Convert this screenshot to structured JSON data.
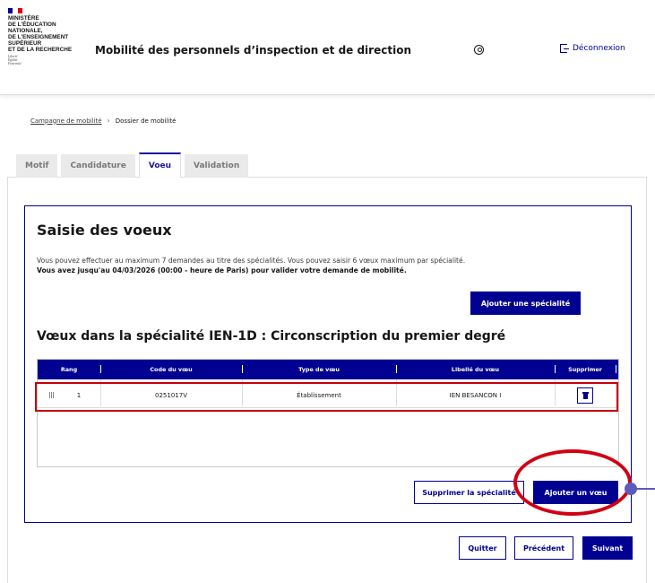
{
  "header": {
    "logo_lines": [
      "Ministère",
      "de l'Éducation",
      "nationale,",
      "de l'Enseignement",
      "supérieur",
      "et de la Recherche"
    ],
    "motto_lines": [
      "Liberté",
      "Égalité",
      "Fraternité"
    ],
    "site_title": "Mobilité des personnels d’inspection et de direction",
    "user_icon": "user-circle-icon",
    "logout_label": "Déconnexion"
  },
  "breadcrumb": {
    "link": "Campagne de mobilité",
    "separator": "›",
    "current": "Dossier de mobilité"
  },
  "tabs": [
    {
      "label": "Motif"
    },
    {
      "label": "Candidature"
    },
    {
      "label": "Voeu",
      "active": true
    },
    {
      "label": "Validation"
    }
  ],
  "card": {
    "title": "Saisie des voeux",
    "info_line1": "Vous pouvez effectuer au maximum 7 demandes au titre des spécialités. Vous pouvez saisir 6 vœux maximum par spécialité.",
    "info_line2": "Vous avez jusqu'au 04/03/2026 (00:00 - heure de Paris) pour valider votre demande de mobilité.",
    "add_specialty_label": "Ajouter une spécialité",
    "specialty_title": "Vœux dans la spécialité IEN-1D : Circonscription du premier degré",
    "delete_specialty_label": "Supprimer la spécialité",
    "add_voeu_label": "Ajouter un vœu"
  },
  "table": {
    "columns": [
      "Rang",
      "Code du vœu",
      "Type de vœu",
      "Libellé du vœu",
      "Supprimer"
    ],
    "rows": [
      {
        "rang": "1",
        "code": "0251017V",
        "type": "Établissement",
        "libelle": "IEN BESANCON I"
      }
    ]
  },
  "footer": {
    "quit_label": "Quitter",
    "prev_label": "Précédent",
    "next_label": "Suivant"
  },
  "colors": {
    "primary": "#000091",
    "highlight": "#d10012",
    "pointer": "#5a5abf"
  }
}
